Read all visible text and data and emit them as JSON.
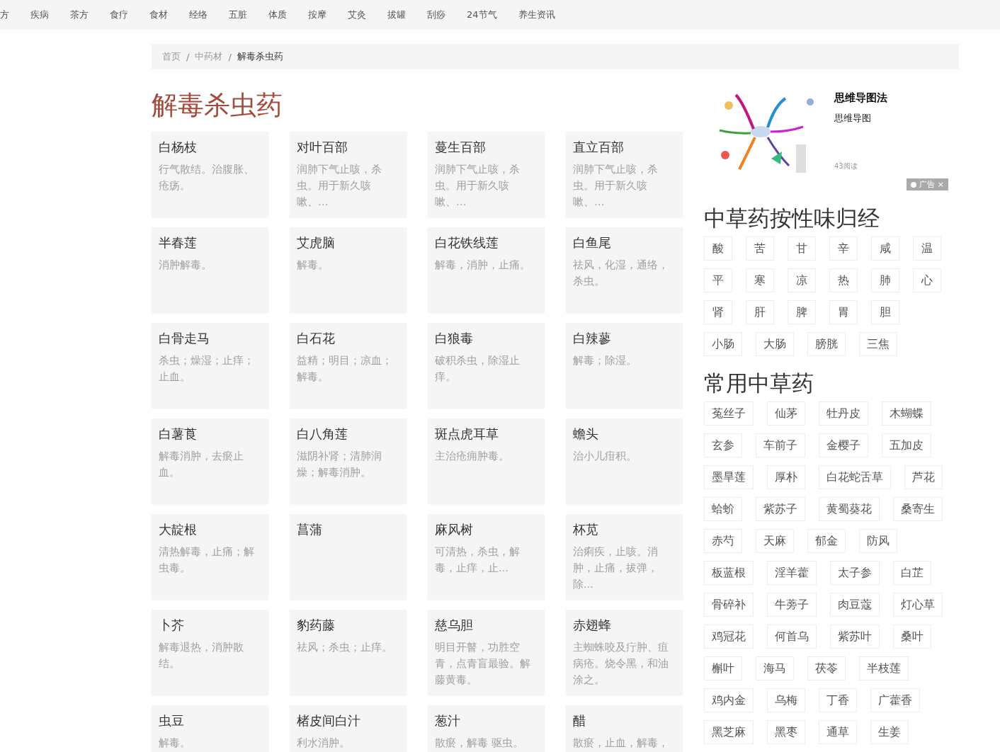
{
  "nav": [
    {
      "label": "方"
    },
    {
      "label": "疾病"
    },
    {
      "label": "茶方"
    },
    {
      "label": "食疗"
    },
    {
      "label": "食材"
    },
    {
      "label": "经络"
    },
    {
      "label": "五脏"
    },
    {
      "label": "体质"
    },
    {
      "label": "按摩"
    },
    {
      "label": "艾灸"
    },
    {
      "label": "拔罐"
    },
    {
      "label": "刮痧"
    },
    {
      "label": "24节气"
    },
    {
      "label": "养生资讯"
    }
  ],
  "breadcrumb_separator": "/",
  "breadcrumb": [
    {
      "label": "首页",
      "current": false
    },
    {
      "label": "中药材",
      "current": false
    },
    {
      "label": "解毒杀虫药",
      "current": true
    }
  ],
  "page_title": "解毒杀虫药",
  "herbs": [
    {
      "name": "白杨枝",
      "description": "行气散结。治腹胀、疮疡。"
    },
    {
      "name": "对叶百部",
      "description": "润肺下气止咳，杀虫。用于新久咳嗽、…"
    },
    {
      "name": "蔓生百部",
      "description": "润肺下气止咳，杀虫。用于新久咳嗽、…"
    },
    {
      "name": "直立百部",
      "description": "润肺下气止咳，杀虫。用于新久咳嗽、…"
    },
    {
      "name": "半春莲",
      "description": "消肿解毒。"
    },
    {
      "name": "艾虎脑",
      "description": "解毒。"
    },
    {
      "name": "白花铁线莲",
      "description": "解毒，消肿，止痛。"
    },
    {
      "name": "白鱼尾",
      "description": "祛风，化湿，通络，杀虫。"
    },
    {
      "name": "白骨走马",
      "description": "杀虫；燥湿；止痒；止血。"
    },
    {
      "name": "白石花",
      "description": "益精；明目；凉血；解毒。"
    },
    {
      "name": "白狼毒",
      "description": "破积杀虫，除湿止痒。"
    },
    {
      "name": "白辣蓼",
      "description": "解毒；除湿。"
    },
    {
      "name": "白薯莨",
      "description": "解毒消肿，去瘀止血。"
    },
    {
      "name": "白八角莲",
      "description": "滋阴补肾；清肺润燥；解毒消肿。"
    },
    {
      "name": "斑点虎耳草",
      "description": "主治疮痈肿毒。"
    },
    {
      "name": "蟾头",
      "description": "治小儿疳积。"
    },
    {
      "name": "大靛根",
      "description": "清热解毒，止痛；解虫毒。"
    },
    {
      "name": "菖蒲"
    },
    {
      "name": "麻风树",
      "description": "可清热，杀虫，解毒，止痒，止..."
    },
    {
      "name": "杯苋",
      "description": "治痢疾，止咳。消肿，止痛，拔弹，除..."
    },
    {
      "name": "卜芥",
      "description": "解毒退热，消肿散结。"
    },
    {
      "name": "豹药藤",
      "description": "祛风；杀虫；止痒。"
    },
    {
      "name": "慈乌胆",
      "description": "明目开瞽，功胜空青，点青盲最验。解藤黄毒。"
    },
    {
      "name": "赤翅蜂",
      "description": "主蜘蛛咬及疔肿、疽病疮。烧令黑，和油涂之。"
    },
    {
      "name": "虫豆",
      "description": "解毒。"
    },
    {
      "name": "楮皮间白汁",
      "description": "利水消肿。"
    },
    {
      "name": "葱汁",
      "description": "散瘀，解毒 驱虫。"
    },
    {
      "name": "醋",
      "description": "散瘀，止血，解毒，"
    }
  ],
  "ad": {
    "kind": "picture",
    "title": "思维导图法",
    "subtitle": "思维导图",
    "reads": "43阅读",
    "badge": "广告",
    "close": "×"
  },
  "taste_section": {
    "title": "中草药按性味归经",
    "tags": [
      "酸",
      "苦",
      "甘",
      "辛",
      "咸",
      "温",
      "平",
      "寒",
      "凉",
      "热",
      "肺",
      "心",
      "肾",
      "肝",
      "脾",
      "胃",
      "胆",
      "小肠",
      "大肠",
      "膀胱",
      "三焦"
    ]
  },
  "common_section": {
    "title": "常用中草药",
    "tags": [
      "菟丝子",
      "仙茅",
      "牡丹皮",
      "木蝴蝶",
      "玄参",
      "车前子",
      "金樱子",
      "五加皮",
      "墨旱莲",
      "厚朴",
      "白花蛇舌草",
      "芦花",
      "蛤蚧",
      "紫苏子",
      "黄蜀葵花",
      "桑寄生",
      "赤芍",
      "天麻",
      "郁金",
      "防风",
      "板蓝根",
      "淫羊藿",
      "太子参",
      "白芷",
      "骨碎补",
      "牛蒡子",
      "肉豆蔻",
      "灯心草",
      "鸡冠花",
      "何首乌",
      "紫苏叶",
      "桑叶",
      "槲叶",
      "海马",
      "茯苓",
      "半枝莲",
      "鸡内金",
      "乌梅",
      "丁香",
      "广藿香",
      "黑芝麻",
      "黑枣",
      "通草",
      "生姜"
    ]
  }
}
